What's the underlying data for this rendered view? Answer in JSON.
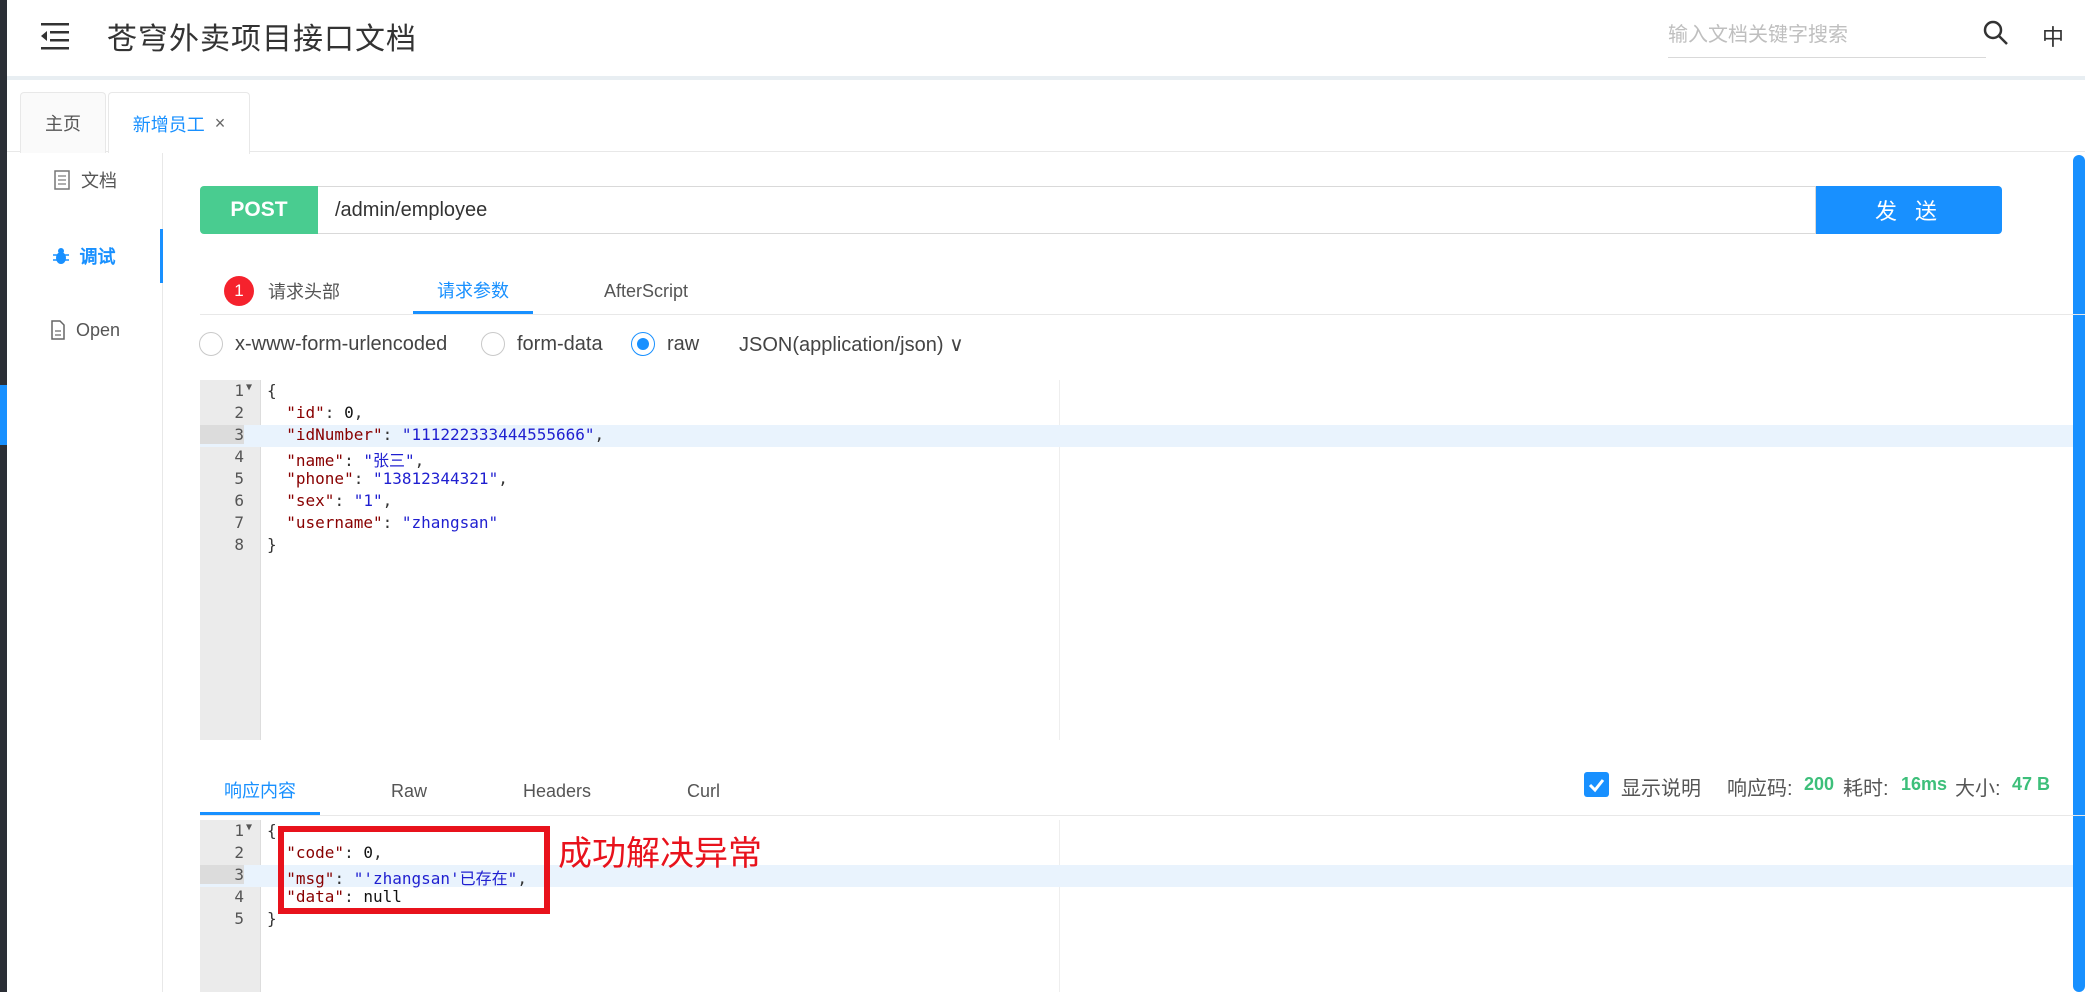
{
  "header": {
    "title": "苍穹外卖项目接口文档",
    "search_placeholder": "输入文档关键字搜索",
    "lang": "中"
  },
  "tabs": {
    "home": "主页",
    "active": "新增员工",
    "close": "×"
  },
  "sidenav": {
    "doc": "文档",
    "debug": "调试",
    "open": "Open"
  },
  "request": {
    "method": "POST",
    "url": "/admin/employee",
    "send": "发 送",
    "tabs": {
      "headers": "请求头部",
      "headers_badge": "1",
      "params": "请求参数",
      "afterscript": "AfterScript"
    },
    "body_types": [
      "x-www-form-urlencoded",
      "form-data",
      "raw"
    ],
    "selected_body_type": "raw",
    "content_type": "JSON(application/json)"
  },
  "request_body": {
    "line_numbers": [
      "1",
      "2",
      "3",
      "4",
      "5",
      "6",
      "7",
      "8"
    ],
    "open": "{",
    "close": "}",
    "fields": [
      {
        "key": "\"id\"",
        "value": "0",
        "kind": "number"
      },
      {
        "key": "\"idNumber\"",
        "value": "\"111222333444555666\"",
        "kind": "string"
      },
      {
        "key": "\"name\"",
        "value": "\"张三\"",
        "kind": "string"
      },
      {
        "key": "\"phone\"",
        "value": "\"13812344321\"",
        "kind": "string"
      },
      {
        "key": "\"sex\"",
        "value": "\"1\"",
        "kind": "string"
      },
      {
        "key": "\"username\"",
        "value": "\"zhangsan\"",
        "kind": "string"
      }
    ]
  },
  "response": {
    "tabs": {
      "content": "响应内容",
      "raw": "Raw",
      "headers": "Headers",
      "curl": "Curl"
    },
    "show_desc": "显示说明",
    "code_label": "响应码:",
    "code_value": "200",
    "time_label": "耗时:",
    "time_value": "16ms",
    "size_label": "大小:",
    "size_value": "47 B",
    "line_numbers": [
      "1",
      "2",
      "3",
      "4",
      "5"
    ],
    "open": "{",
    "close": "}",
    "fields": [
      {
        "key": "\"code\"",
        "value": "0",
        "kind": "number"
      },
      {
        "key": "\"msg\"",
        "value": "\"'zhangsan'已存在\"",
        "kind": "string"
      },
      {
        "key": "\"data\"",
        "value": "null",
        "kind": "number"
      }
    ]
  },
  "annotation": {
    "text": "成功解决异常",
    "color": "#e8121c"
  },
  "colors": {
    "accent": "#1890ff",
    "post": "#49cc90",
    "badge": "#f5222d"
  }
}
